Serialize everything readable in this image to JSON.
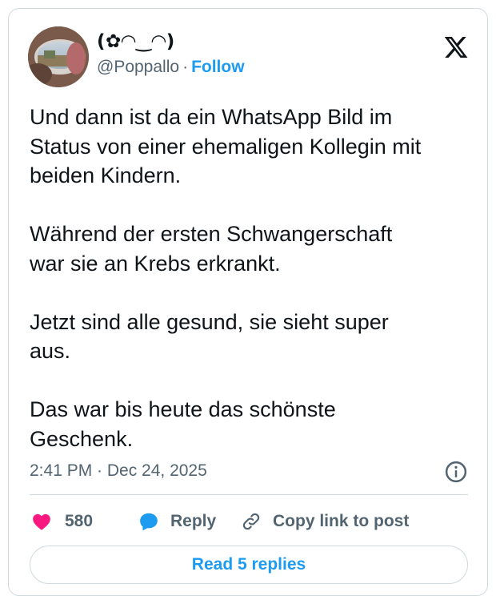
{
  "author": {
    "display_name": "(✿◠‿◠)",
    "handle": "@Poppallo",
    "separator": "·",
    "follow_label": "Follow"
  },
  "tweet": {
    "text": "Und dann ist da ein WhatsApp Bild im\nStatus von einer ehemaligen Kollegin mit\nbeiden Kindern.\n\nWährend der ersten Schwangerschaft\nwar sie an Krebs erkrankt.\n\nJetzt sind alle gesund, sie sieht super\naus.\n\nDas war bis heute das schönste\nGeschenk.",
    "timestamp": "2:41 PM · Dec 24, 2025"
  },
  "actions": {
    "like_count": "580",
    "reply_label": "Reply",
    "copy_label": "Copy link to post"
  },
  "read_replies_label": "Read 5 replies",
  "colors": {
    "accent": "#1d9bf0",
    "like": "#f91880",
    "muted": "#536471",
    "border": "#cfd9de"
  },
  "icons": [
    "x-logo-icon",
    "info-icon",
    "heart-icon",
    "reply-bubble-icon",
    "link-icon"
  ]
}
